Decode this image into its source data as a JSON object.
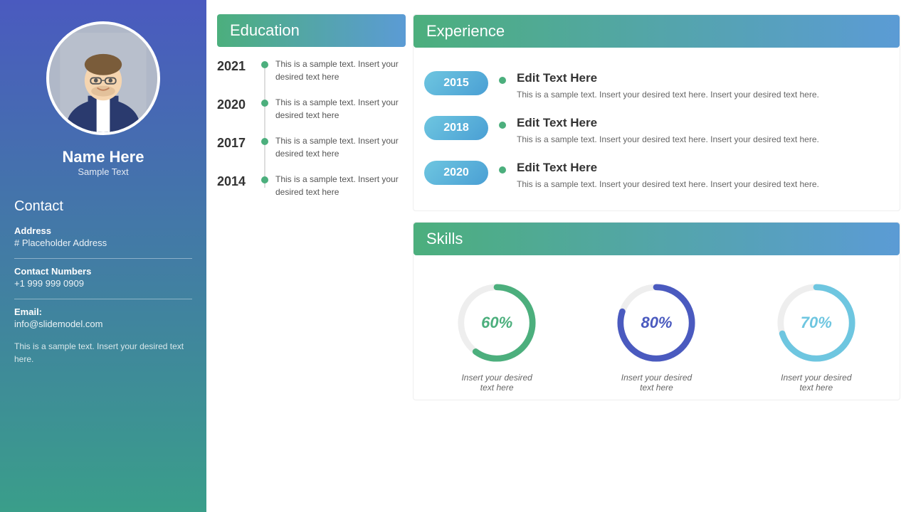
{
  "sidebar": {
    "name": "Name Here",
    "subtitle": "Sample Text",
    "contact_title": "Contact",
    "address_label": "Address",
    "address_value": "# Placeholder Address",
    "phone_label": "Contact Numbers",
    "phone_value": "+1 999 999 0909",
    "email_label": "Email:",
    "email_value": "info@slidemodel.com",
    "footer_text": "This is a sample text. Insert your desired text here."
  },
  "education": {
    "title": "Education",
    "items": [
      {
        "year": "2021",
        "text": "This is a sample text. Insert your desired text here"
      },
      {
        "year": "2020",
        "text": "This is a sample text. Insert your desired text here"
      },
      {
        "year": "2017",
        "text": "This is a sample text. Insert your desired text here"
      },
      {
        "year": "2014",
        "text": "This is a sample text. Insert your desired text here"
      }
    ]
  },
  "experience": {
    "title": "Experience",
    "items": [
      {
        "year": "2015",
        "heading": "Edit Text Here",
        "desc": "This is a sample text. Insert your desired text here. Insert your desired text here."
      },
      {
        "year": "2018",
        "heading": "Edit Text Here",
        "desc": "This is a sample text. Insert your desired text here. Insert your desired text here."
      },
      {
        "year": "2020",
        "heading": "Edit Text Here",
        "desc": "This is a sample text. Insert your desired text here. Insert your desired text here."
      }
    ]
  },
  "skills": {
    "title": "Skills",
    "items": [
      {
        "percent": 60,
        "label": "Insert your desired\ntext here",
        "color": "#4CAF7D",
        "pct_display": "60%"
      },
      {
        "percent": 80,
        "label": "Insert your desired\ntext here",
        "color": "#4a5abf",
        "pct_display": "80%"
      },
      {
        "percent": 70,
        "label": "Insert your desired\ntext here",
        "color": "#6ec6e0",
        "pct_display": "70%"
      }
    ]
  }
}
